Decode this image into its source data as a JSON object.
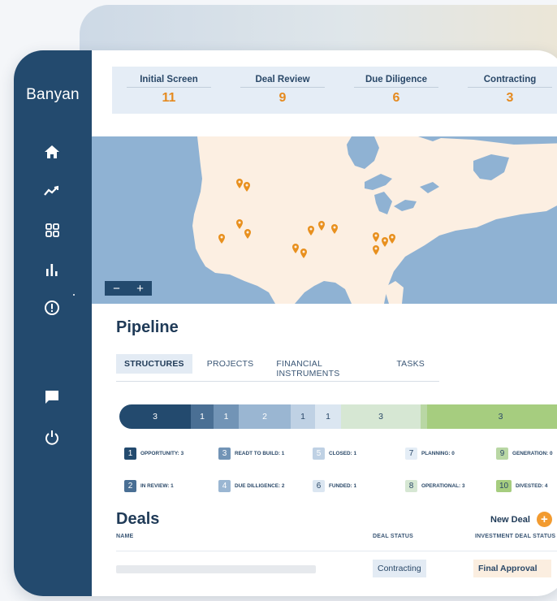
{
  "app": {
    "logo": "Banyan"
  },
  "sidebar": {
    "items": [
      {
        "icon": "home-icon"
      },
      {
        "icon": "trend-icon"
      },
      {
        "icon": "grid-icon"
      },
      {
        "icon": "bar-chart-icon"
      },
      {
        "icon": "alert-icon"
      },
      {
        "icon": "chat-icon"
      },
      {
        "icon": "power-icon"
      }
    ]
  },
  "stages": [
    {
      "label": "Initial Screen",
      "count": "11"
    },
    {
      "label": "Deal Review",
      "count": "9"
    },
    {
      "label": "Due Diligence",
      "count": "6"
    },
    {
      "label": "Contracting",
      "count": "3"
    }
  ],
  "map": {
    "zoom_out": "−",
    "zoom_in": "+"
  },
  "pipeline": {
    "title": "Pipeline",
    "tabs": [
      "STRUCTURES",
      "PROJECTS",
      "FINANCIAL INSTRUMENTS",
      "TASKS"
    ],
    "bar": [
      {
        "value": "3",
        "color": "#234a6e",
        "text": "#ffffff"
      },
      {
        "value": "1",
        "color": "#4a6f94",
        "text": "#ffffff"
      },
      {
        "value": "1",
        "color": "#7294b6",
        "text": "#ffffff"
      },
      {
        "value": "2",
        "color": "#9ab6d2",
        "text": "#ffffff"
      },
      {
        "value": "1",
        "color": "#bfd1e4",
        "text": "#2a4868"
      },
      {
        "value": "1",
        "color": "#dbe6f1",
        "text": "#2a4868"
      },
      {
        "value": "3",
        "color": "#d6e7d3",
        "text": "#2a4868"
      },
      {
        "value": "",
        "color": "#b9d7a4",
        "text": "#2a4868"
      },
      {
        "value": "3",
        "color": "#a6cd7f",
        "text": "#2a4868"
      }
    ],
    "legend": [
      {
        "num": "1",
        "label": "OPPORTUNITY: 3",
        "color": "#234a6e",
        "text": "#ffffff"
      },
      {
        "num": "3",
        "label": "READT TO BUILD: 1",
        "color": "#7294b6",
        "text": "#ffffff"
      },
      {
        "num": "5",
        "label": "CLOSED: 1",
        "color": "#bfd1e4",
        "text": "#ffffff"
      },
      {
        "num": "7",
        "label": "PLANNING: 0",
        "color": "#e4edf6",
        "text": "#2a4868"
      },
      {
        "num": "9",
        "label": "GENERATION: 0",
        "color": "#b9d7a4",
        "text": "#2a4868"
      },
      {
        "num": "2",
        "label": "IN REVIEW: 1",
        "color": "#4a6f94",
        "text": "#ffffff"
      },
      {
        "num": "4",
        "label": "DUE DILLIGENCE: 2",
        "color": "#9ab6d2",
        "text": "#ffffff"
      },
      {
        "num": "6",
        "label": "FUNDED: 1",
        "color": "#dbe6f1",
        "text": "#2a4868"
      },
      {
        "num": "8",
        "label": "OPERATIONAL: 3",
        "color": "#d6e7d3",
        "text": "#2a4868"
      },
      {
        "num": "10",
        "label": "DIVESTED: 4",
        "color": "#a6cd7f",
        "text": "#2a4868"
      }
    ]
  },
  "deals": {
    "title": "Deals",
    "new_deal_label": "New Deal",
    "new_deal_icon": "+",
    "columns": {
      "name": "NAME",
      "status": "DEAL STATUS",
      "investment_status": "INVESTMENT DEAL STATUS"
    },
    "rows": [
      {
        "status": "Contracting",
        "investment_status": "Final Approval"
      }
    ]
  },
  "colors": {
    "sidebar": "#234a6e",
    "accent": "#e58a1f",
    "map_water": "#8fb2d3",
    "map_land": "#fcefe2",
    "marker": "#e8901e"
  }
}
